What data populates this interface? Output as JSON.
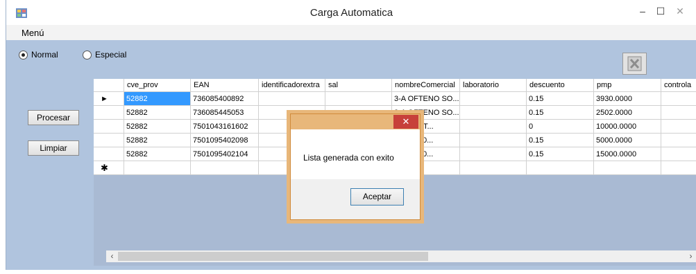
{
  "window": {
    "title": "Carga Automatica",
    "minimize": "–",
    "maximize": "☐",
    "close": "✕"
  },
  "menubar": {
    "menu_label": "Menú"
  },
  "mode": {
    "options": [
      {
        "label": "Normal",
        "selected": true
      },
      {
        "label": "Especial",
        "selected": false
      }
    ]
  },
  "actions": {
    "process_label": "Procesar",
    "clear_label": "Limpiar"
  },
  "grid": {
    "columns": [
      "cve_prov",
      "EAN",
      "identificadorextra",
      "sal",
      "nombreComercial",
      "laboratorio",
      "descuento",
      "pmp",
      "controla"
    ],
    "current_row_marker": "►",
    "new_row_marker": "✱",
    "rows": [
      [
        "52882",
        "736085400892",
        "",
        "",
        "3-A OFTENO SO...",
        "",
        "0.15",
        "3930.0000",
        ""
      ],
      [
        "52882",
        "736085445053",
        "",
        "",
        "3-A OFTENO SO...",
        "",
        "0.15",
        "2502.0000",
        ""
      ],
      [
        "52882",
        "7501043161602",
        "",
        "",
        "0MG 60 T...",
        "",
        "0",
        "10000.0000",
        ""
      ],
      [
        "52882",
        "7501095402098",
        "",
        "",
        "Y T 10 20...",
        "",
        "0.15",
        "5000.0000",
        ""
      ],
      [
        "52882",
        "7501095402104",
        "",
        "",
        "Y T 10 30...",
        "",
        "0.15",
        "15000.0000",
        ""
      ]
    ],
    "scroll_left": "‹",
    "scroll_right": "›",
    "scroll_position": 0
  },
  "dialog": {
    "close": "✕",
    "message": "Lista generada con exito",
    "ok_label": "Aceptar"
  },
  "colors": {
    "form_background": "#b0c4de",
    "selected_cell": "#3399ff",
    "dialog_accent": "#e8b77a",
    "close_red": "#c7403a"
  }
}
